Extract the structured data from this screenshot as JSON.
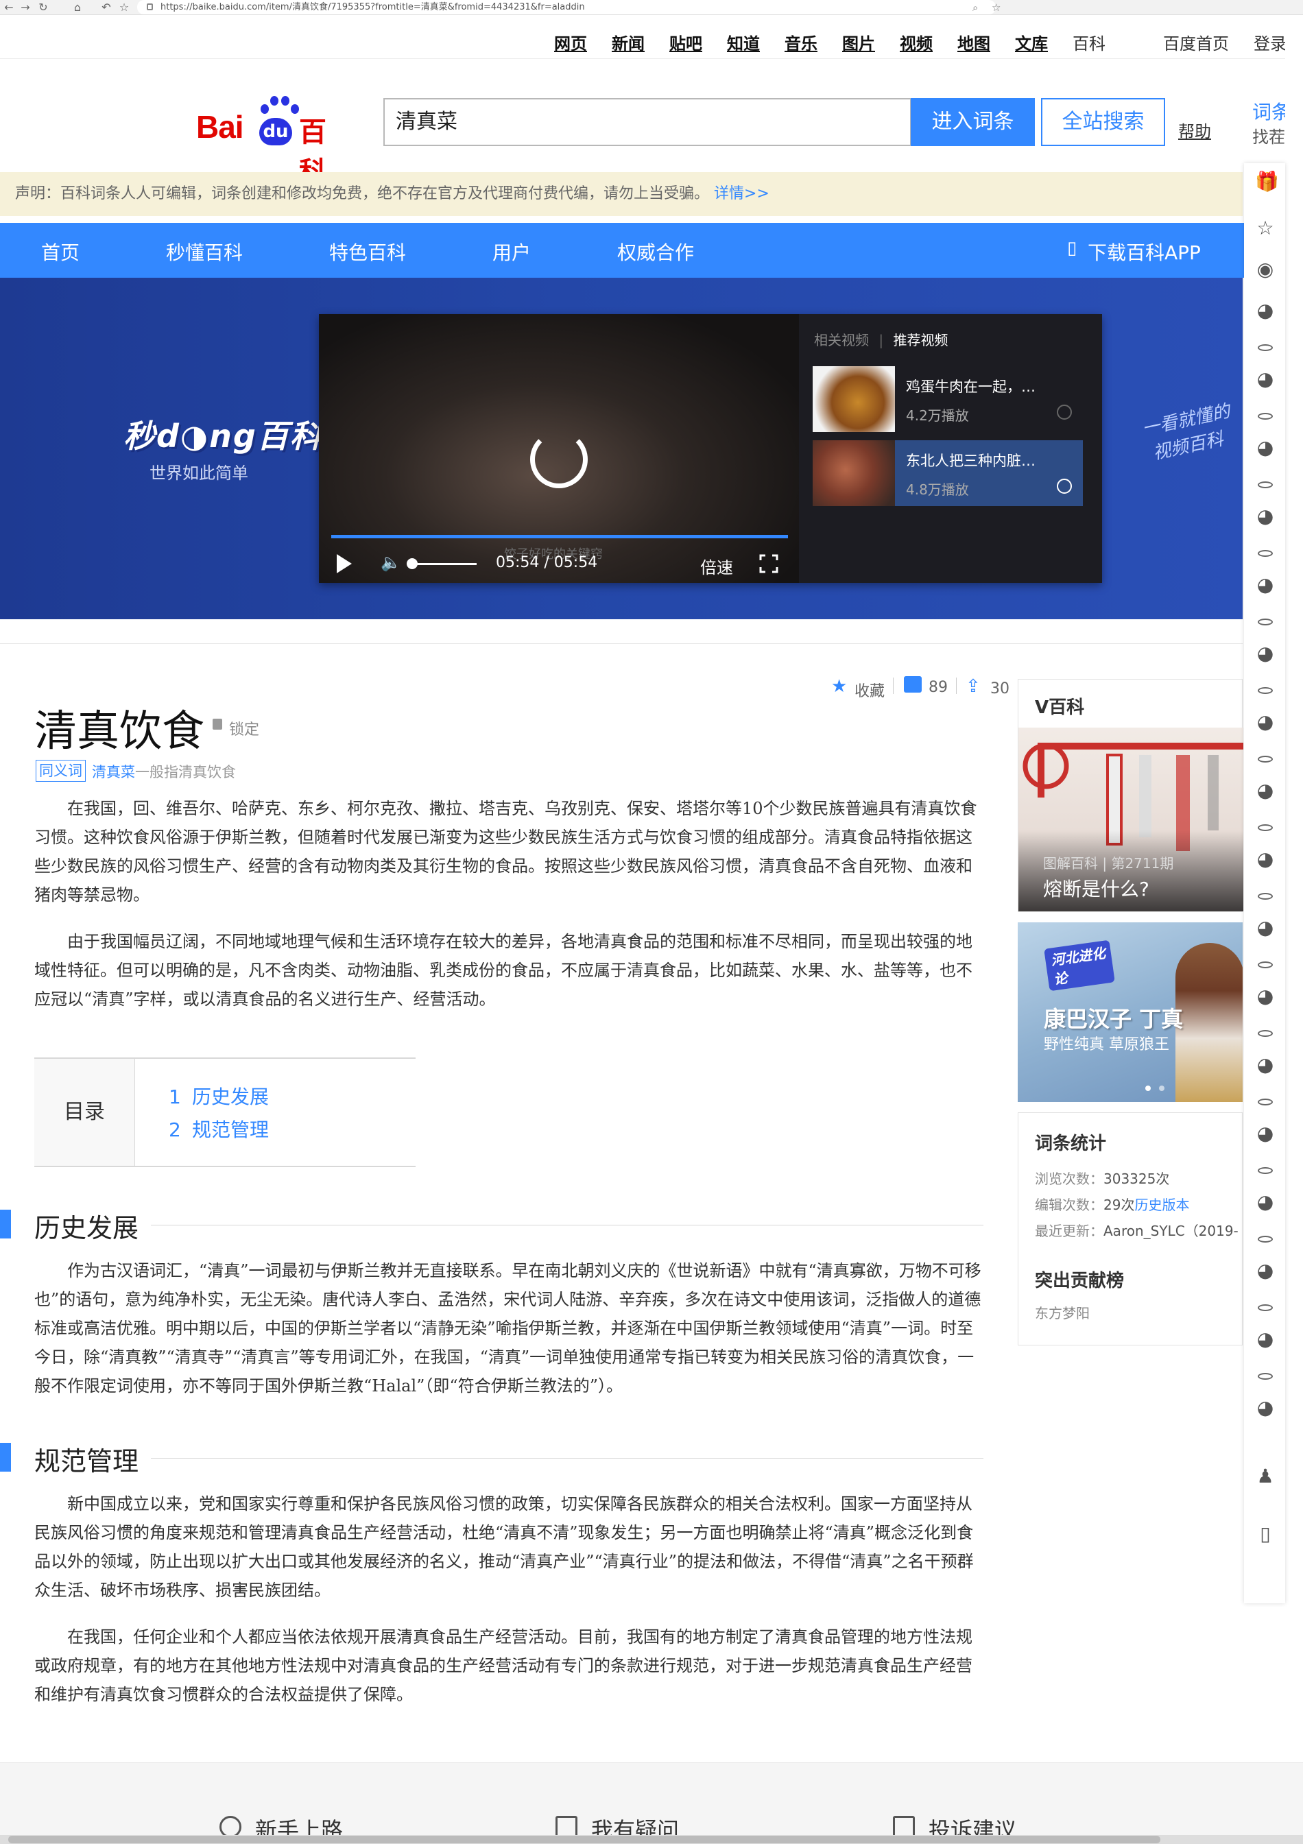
{
  "browser": {
    "url": "https://baike.baidu.com/item/清真饮食/7195355?fromtitle=清真菜&fromid=4434231&fr=aladdin"
  },
  "top_nav": {
    "links": [
      "网页",
      "新闻",
      "贴吧",
      "知道",
      "音乐",
      "图片",
      "视频",
      "地图",
      "文库",
      "百科"
    ],
    "home": "百度首页",
    "login": "登录"
  },
  "header": {
    "logo_bai": "Bai",
    "logo_du": "du",
    "logo_bk": "百科",
    "search_value": "清真菜",
    "enter_label": "进入词条",
    "site_search_label": "全站搜索",
    "help_label": "帮助",
    "promo_line1": "词条大",
    "promo_line2": "找茬有"
  },
  "notice": {
    "text": "声明：百科词条人人可编辑，词条创建和修改均免费，绝不存在官方及代理商付费代编，请勿上当受骗。",
    "link": "详情>>"
  },
  "blue_nav": {
    "items": [
      "首页",
      "秒懂百科",
      "特色百科",
      "用户",
      "权威合作"
    ],
    "app": "下载百科APP"
  },
  "banner": {
    "brand": "秒d◑ng百科",
    "slogan": "世界如此简单",
    "hand_line1": "一看就懂的",
    "hand_line2": "视频百科",
    "player": {
      "caption": "饺子好吃的关键窍",
      "time": "05:54 / 05:54",
      "speed": "倍速",
      "progress": 1.0
    },
    "related": {
      "tab_related": "相关视频",
      "tab_recommend": "推荐视频",
      "items": [
        {
          "title": "鸡蛋牛肉在一起，…",
          "views": "4.2万播放"
        },
        {
          "title": "东北人把三种内脏…",
          "views": "4.8万播放"
        }
      ]
    }
  },
  "article": {
    "actions": {
      "fav": "收藏",
      "likes": "89",
      "shares": "30"
    },
    "title": "清真饮食",
    "lock": "锁定",
    "synonym_tag": "同义词",
    "synonym_link": "清真菜",
    "synonym_rest": "一般指清真饮食",
    "intro": [
      "在我国，回、维吾尔、哈萨克、东乡、柯尔克孜、撒拉、塔吉克、乌孜别克、保安、塔塔尔等10个少数民族普遍具有清真饮食习惯。这种饮食风俗源于伊斯兰教，但随着时代发展已渐变为这些少数民族生活方式与饮食习惯的组成部分。清真食品特指依据这些少数民族的风俗习惯生产、经营的含有动物肉类及其衍生物的食品。按照这些少数民族风俗习惯，清真食品不含自死物、血液和猪肉等禁忌物。",
      "由于我国幅员辽阔，不同地域地理气候和生活环境存在较大的差异，各地清真食品的范围和标准不尽相同，而呈现出较强的地域性特征。但可以明确的是，凡不含肉类、动物油脂、乳类成份的食品，不应属于清真食品，比如蔬菜、水果、水、盐等等，也不应冠以“清真”字样，或以清真食品的名义进行生产、经营活动。"
    ],
    "toc": {
      "head": "目录",
      "items": [
        {
          "num": "1",
          "label": "历史发展"
        },
        {
          "num": "2",
          "label": "规范管理"
        }
      ]
    },
    "sections": [
      {
        "title": "历史发展",
        "paras": [
          "作为古汉语词汇，“清真”一词最初与伊斯兰教并无直接联系。早在南北朝刘义庆的《世说新语》中就有“清真寡欲，万物不可移也”的语句，意为纯净朴实，无尘无染。唐代诗人李白、孟浩然，宋代词人陆游、辛弃疾，多次在诗文中使用该词，泛指做人的道德标准或高洁优雅。明中期以后，中国的伊斯兰学者以“清静无染”喻指伊斯兰教，并逐渐在中国伊斯兰教领域使用“清真”一词。时至今日，除“清真教”“清真寺”“清真言”等专用词汇外，在我国，“清真”一词单独使用通常专指已转变为相关民族习俗的清真饮食，一般不作限定词使用，亦不等同于国外伊斯兰教“Halal”（即“符合伊斯兰教法的”）。"
        ]
      },
      {
        "title": "规范管理",
        "paras": [
          "新中国成立以来，党和国家实行尊重和保护各民族风俗习惯的政策，切实保障各民族群众的相关合法权利。国家一方面坚持从民族风俗习惯的角度来规范和管理清真食品生产经营活动，杜绝“清真不清”现象发生；另一方面也明确禁止将“清真”概念泛化到食品以外的领域，防止出现以扩大出口或其他发展经济的名义，推动“清真产业”“清真行业”的提法和做法，不得借“清真”之名干预群众生活、破坏市场秩序、损害民族团结。",
          "在我国，任何企业和个人都应当依法依规开展清真食品生产经营活动。目前，我国有的地方制定了清真食品管理的地方性法规或政府规章，有的地方在其他地方性法规中对清真食品的生产经营活动有专门的条款进行规范，对于进一步规范清真食品生产经营和维护有清真饮食习惯群众的合法权益提供了保障。"
        ]
      }
    ]
  },
  "sidebar": {
    "vbk_head": "V百科",
    "vbk_sub": "图解百科 | 第2711期",
    "vbk_caption": "熔断是什么?",
    "promo_badge": "河北进化论",
    "promo_title": "康巴汉子 丁真",
    "promo_sub": "野性纯真 草原狼王",
    "stats_head": "词条统计",
    "views_label": "浏览次数：",
    "views": "303325次",
    "edits_label": "编辑次数：",
    "edits": "29次",
    "history_link": "历史版本",
    "updated_label": "最近更新：",
    "updated": "Aaron_SYLC（2019-",
    "contrib_head": "突出贡献榜",
    "contrib_name": "东方梦阳"
  },
  "footer": {
    "items": [
      "新手上路",
      "我有疑问",
      "投诉建议"
    ]
  }
}
